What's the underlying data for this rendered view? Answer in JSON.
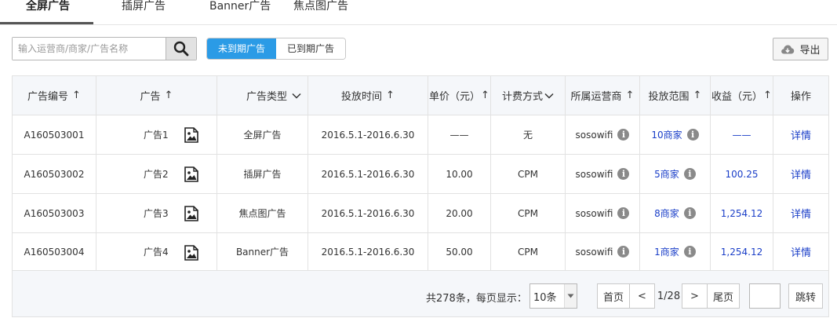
{
  "tabs": [
    {
      "label": "全屏广告",
      "active": true
    },
    {
      "label": "插屏广告",
      "active": false
    },
    {
      "label": "Banner广告",
      "active": false
    },
    {
      "label": "焦点图广告",
      "active": false
    }
  ],
  "toolbar": {
    "search_placeholder": "输入运营商/商家/广告名称",
    "search_value": "",
    "filter_buttons": [
      {
        "label": "未到期广告",
        "active": true
      },
      {
        "label": "已到期广告",
        "active": false
      }
    ],
    "export_label": "导出",
    "accent_color": "#2b9be6"
  },
  "table": {
    "headers": {
      "code": "广告编号",
      "ad": "广告",
      "type": "广告类型",
      "time": "投放时间",
      "price": "单价（元）",
      "billing": "计费方式",
      "operator": "所属运营商",
      "range": "投放范围",
      "revenue": "收益（元）",
      "action": "操作"
    },
    "sort_arrow": "↑",
    "rows": [
      {
        "code": "A160503001",
        "ad": "广告1",
        "type": "全屏广告",
        "time": "2016.5.1-2016.6.30",
        "price": "——",
        "billing": "无",
        "operator": "sosowifi",
        "range": "10商家",
        "revenue": "——",
        "action": "详情"
      },
      {
        "code": "A160503002",
        "ad": "广告2",
        "type": "插屏广告",
        "time": "2016.5.1-2016.6.30",
        "price": "10.00",
        "billing": "CPM",
        "operator": "sosowifi",
        "range": "5商家",
        "revenue": "100.25",
        "action": "详情"
      },
      {
        "code": "A160503003",
        "ad": "广告3",
        "type": "焦点图广告",
        "time": "2016.5.1-2016.6.30",
        "price": "20.00",
        "billing": "CPM",
        "operator": "sosowifi",
        "range": "8商家",
        "revenue": "1,254.12",
        "action": "详情"
      },
      {
        "code": "A160503004",
        "ad": "广告4",
        "type": "Banner广告",
        "time": "2016.5.1-2016.6.30",
        "price": "50.00",
        "billing": "CPM",
        "operator": "sosowifi",
        "range": "1商家",
        "revenue": "1,254.12",
        "action": "详情"
      }
    ],
    "link_color": "#1a3ec8"
  },
  "pagination": {
    "summary": "共278条，每页显示：",
    "page_size": "10条",
    "first": "首页",
    "prev": "<",
    "page_info": "1/28",
    "next": ">",
    "last": "尾页",
    "jump_value": "",
    "jump_label": "跳转"
  }
}
